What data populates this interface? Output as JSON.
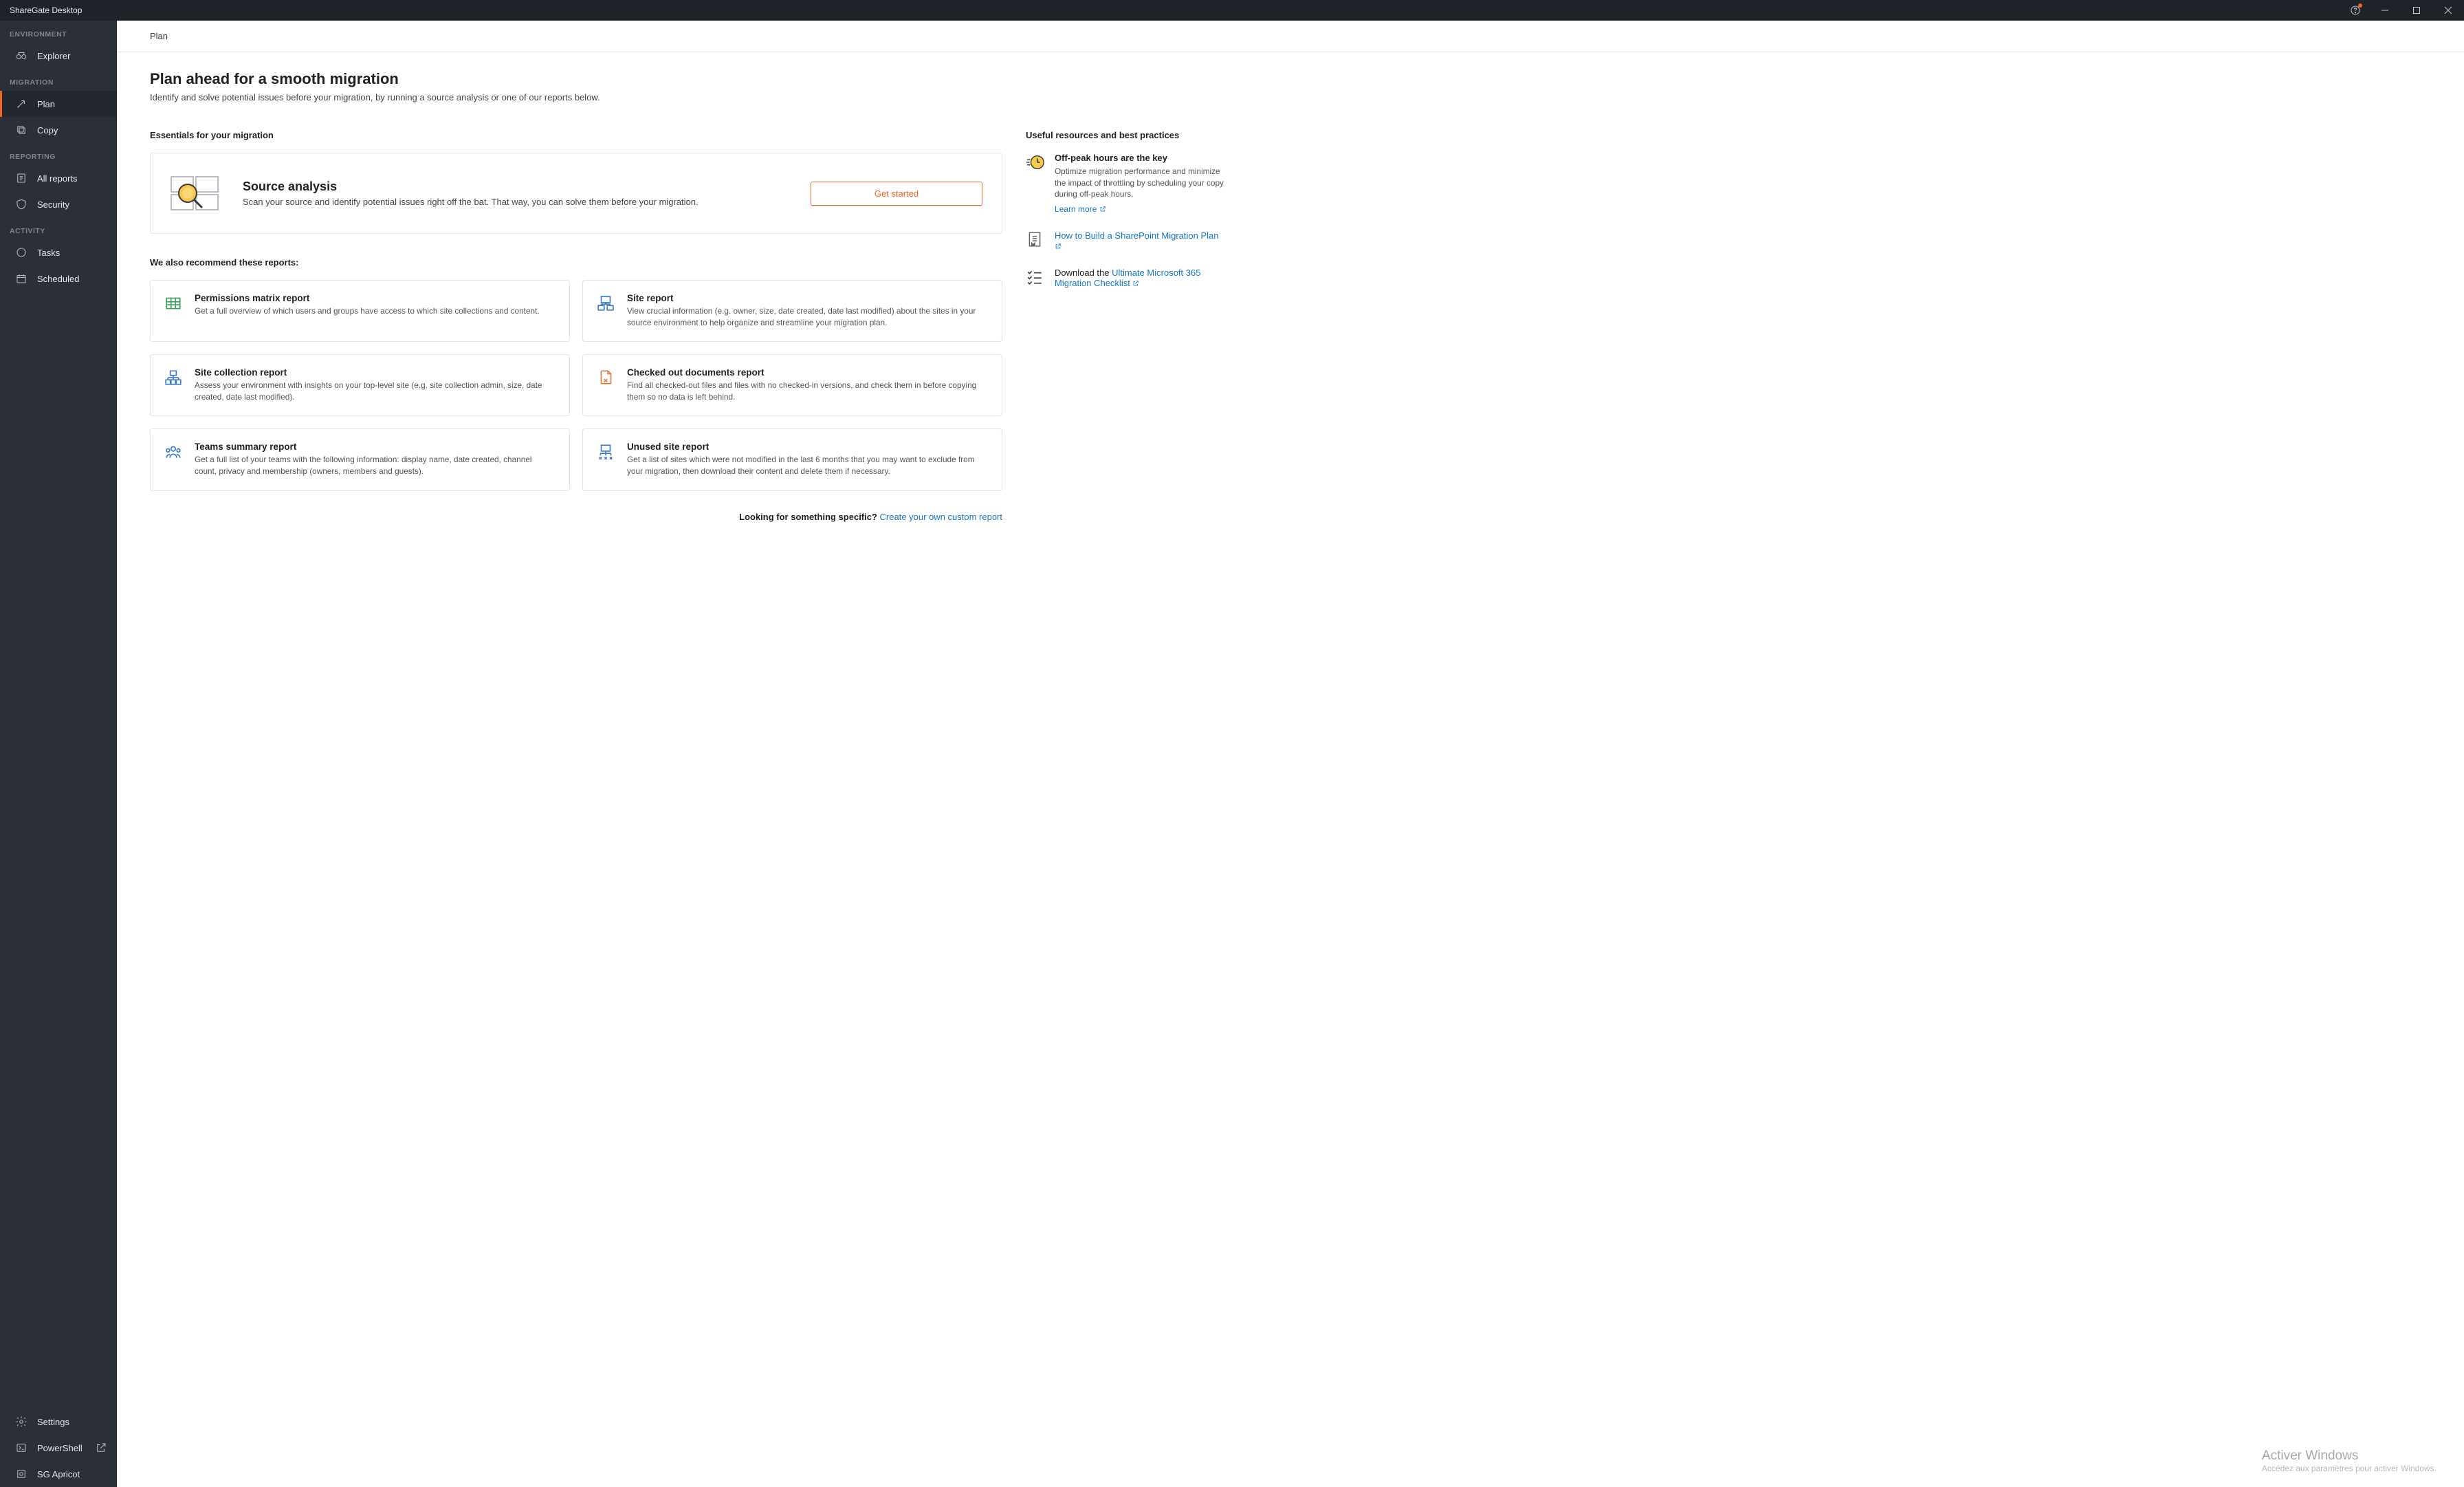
{
  "titlebar": {
    "app_name": "ShareGate Desktop"
  },
  "sidebar": {
    "groups": [
      {
        "label": "ENVIRONMENT",
        "items": [
          {
            "name": "explorer",
            "label": "Explorer"
          }
        ]
      },
      {
        "label": "MIGRATION",
        "items": [
          {
            "name": "plan",
            "label": "Plan",
            "active": true
          },
          {
            "name": "copy",
            "label": "Copy"
          }
        ]
      },
      {
        "label": "REPORTING",
        "items": [
          {
            "name": "all-reports",
            "label": "All reports"
          },
          {
            "name": "security",
            "label": "Security"
          }
        ]
      },
      {
        "label": "ACTIVITY",
        "items": [
          {
            "name": "tasks",
            "label": "Tasks"
          },
          {
            "name": "scheduled",
            "label": "Scheduled"
          }
        ]
      }
    ],
    "bottom": [
      {
        "name": "settings",
        "label": "Settings"
      },
      {
        "name": "powershell",
        "label": "PowerShell",
        "external": true
      },
      {
        "name": "sg-apricot",
        "label": "SG Apricot"
      }
    ]
  },
  "content": {
    "tab": "Plan",
    "title": "Plan ahead for a smooth migration",
    "subtitle": "Identify and solve potential issues before your migration, by running a source analysis or one of our reports below.",
    "essentials_heading": "Essentials for your migration",
    "source_analysis": {
      "title": "Source analysis",
      "desc": "Scan your source and identify potential issues right off the bat. That way, you can solve them before your migration.",
      "button": "Get started"
    },
    "recommend_heading": "We also recommend these reports:",
    "reports": [
      {
        "name": "permissions-matrix",
        "title": "Permissions matrix report",
        "desc": "Get a full overview of which users and groups have access to which site collections and content."
      },
      {
        "name": "site-report",
        "title": "Site report",
        "desc": "View crucial information (e.g. owner, size, date created, date last modified) about the sites in your source environment to help organize and streamline your migration plan."
      },
      {
        "name": "site-collection",
        "title": "Site collection report",
        "desc": "Assess your environment with insights on your top-level site (e.g. site collection admin, size, date created, date last modified)."
      },
      {
        "name": "checked-out",
        "title": "Checked out documents report",
        "desc": "Find all checked-out files and files with no checked-in versions, and check them in before copying them so no data is left behind."
      },
      {
        "name": "teams-summary",
        "title": "Teams summary report",
        "desc": "Get a full list of your teams with the following information: display name, date created, channel count, privacy and membership (owners, members and guests)."
      },
      {
        "name": "unused-site",
        "title": "Unused site report",
        "desc": "Get a list of sites which were not modified in the last 6 months that you may want to exclude from your migration, then download their content and delete them if necessary."
      }
    ],
    "looking_prefix": "Looking for something specific? ",
    "looking_link": "Create your own custom report"
  },
  "resources": {
    "heading": "Useful resources and best practices",
    "offpeak": {
      "title": "Off-peak hours are the key",
      "desc": "Optimize migration performance and minimize the impact of throttling by scheduling your copy during off-peak hours.",
      "learn": "Learn more"
    },
    "howto_link": "How to Build a SharePoint Migration Plan",
    "download_prefix": "Download the ",
    "download_link": "Ultimate Microsoft 365 Migration Checklist"
  },
  "watermark": {
    "line1": "Activer Windows",
    "line2": "Accédez aux paramètres pour activer Windows."
  }
}
